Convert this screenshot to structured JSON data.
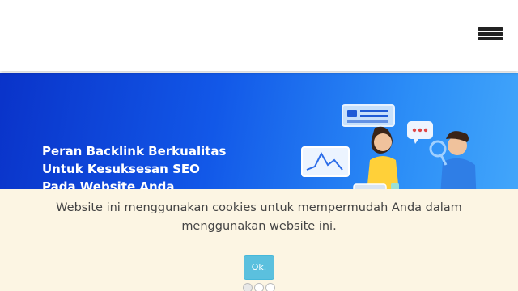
{
  "header": {
    "menu_icon": "hamburger-menu-icon"
  },
  "banner": {
    "title_lines": [
      "Peran Backlink Berkualitas",
      "Untuk Kesuksesan SEO",
      "Pada Website Anda"
    ],
    "illustration": "people-with-laptop-chart-and-magnifier-illustration",
    "colors": {
      "gradient_start": "#0a33c9",
      "gradient_end": "#45a9fb"
    }
  },
  "cookie_notice": {
    "message": "Website ini menggunakan cookies untuk mempermudah Anda dalam menggunakan website ini.",
    "ok_label": "Ok.",
    "colors": {
      "background": "#fcf5e3",
      "button": "#5bc0de"
    }
  },
  "slider": {
    "dot_count": 3,
    "active_index": 0
  }
}
